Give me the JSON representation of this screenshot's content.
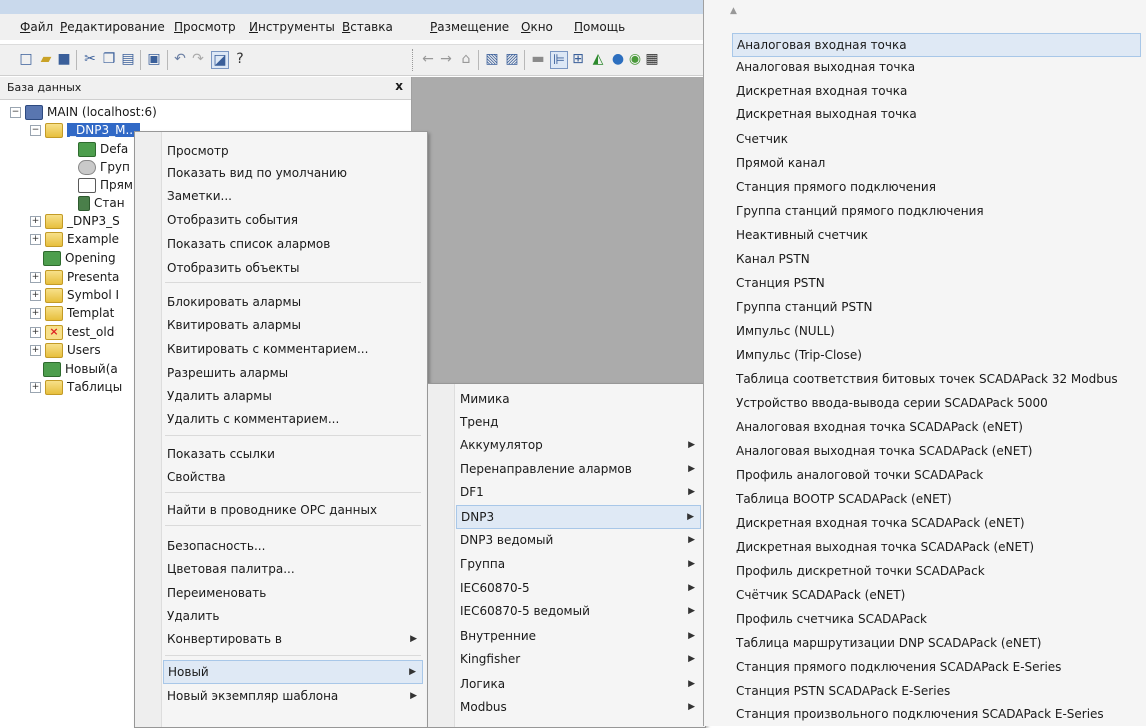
{
  "menubar": {
    "items": [
      {
        "label": "Файл",
        "u": "Ф",
        "rest": "айл"
      },
      {
        "label": "Редактирование",
        "u": "Р",
        "rest": "едактирование"
      },
      {
        "label": "Просмотр",
        "u": "П",
        "rest": "росмотр"
      },
      {
        "label": "Инструменты",
        "u": "И",
        "rest": "нструменты"
      },
      {
        "label": "Вставка",
        "u": "В",
        "rest": "ставка"
      },
      {
        "label": "Размещение",
        "u": "Р",
        "rest": "азмещение"
      },
      {
        "label": "Окно",
        "u": "О",
        "rest": "кно"
      },
      {
        "label": "Помощь",
        "u": "П",
        "rest": "омощь"
      }
    ]
  },
  "db_panel": {
    "title": "База данных",
    "close": "x",
    "tree": [
      {
        "label": "MAIN (localhost:6)",
        "icon": "pc-icon"
      },
      {
        "label": "_DNP3_M...",
        "icon": "folder-icon"
      },
      {
        "label": "Defa",
        "icon": "green-icon"
      },
      {
        "label": "Груп",
        "icon": "group-icon"
      },
      {
        "label": "Прям",
        "icon": "direct-icon"
      },
      {
        "label": "Стан",
        "icon": "station-icon"
      },
      {
        "label": "_DNP3_S",
        "icon": "folder-icon"
      },
      {
        "label": "Example",
        "icon": "folder-icon"
      },
      {
        "label": "Opening",
        "icon": "green-icon"
      },
      {
        "label": "Presenta",
        "icon": "folder-icon"
      },
      {
        "label": "Symbol I",
        "icon": "folder-icon"
      },
      {
        "label": "Templat",
        "icon": "folder-icon"
      },
      {
        "label": "test_old",
        "icon": "folder-x-icon"
      },
      {
        "label": "Users",
        "icon": "folder-icon"
      },
      {
        "label": "Новый(а",
        "icon": "green-icon"
      },
      {
        "label": "Таблицы",
        "icon": "folder-icon"
      }
    ]
  },
  "context_menu": {
    "items": [
      "Просмотр",
      "Показать вид по умолчанию",
      "Заметки...",
      "Отобразить события",
      "Показать список алармов",
      "Отобразить объекты",
      "Блокировать алармы",
      "Квитировать алармы",
      "Квитировать с комментарием...",
      "Разрешить алармы",
      "Удалить алармы",
      "Удалить с комментарием...",
      "Показать ссылки",
      "Свойства",
      "Найти в проводнике OPC данных",
      "Безопасность...",
      "Цветовая палитра...",
      "Переименовать",
      "Удалить",
      "Конвертировать в",
      "Новый",
      "Новый экземпляр шаблона"
    ]
  },
  "submenu_new": {
    "items": [
      "Мимика",
      "Тренд",
      "Аккумулятор",
      "Перенаправление алармов",
      "DF1",
      "DNP3",
      "DNP3 ведомый",
      "Группа",
      "IEC60870-5",
      "IEC60870-5 ведомый",
      "Внутренние",
      "Kingfisher",
      "Логика",
      "Modbus"
    ]
  },
  "submenu_dnp3": {
    "scroll_up": "▲",
    "items": [
      "Аналоговая входная точка",
      "Аналоговая выходная точка",
      "Дискретная входная точка",
      "Дискретная выходная точка",
      "Счетчик",
      "Прямой канал",
      "Станция прямого подключения",
      "Группа станций прямого подключения",
      "Неактивный счетчик",
      "Канал PSTN",
      "Станция PSTN",
      "Группа станций PSTN",
      "Импульс (NULL)",
      "Импульс (Trip-Close)",
      "Таблица соответствия битовых точек SCADAPack 32 Modbus",
      "Устройство ввода-вывода серии SCADAPack 5000",
      "Аналоговая входная точка SCADAPack (eNET)",
      "Аналоговая выходная точка SCADAPack (eNET)",
      "Профиль аналоговой точки SCADAPack",
      "Таблица BOOTP SCADAPack (eNET)",
      "Дискретная входная точка SCADAPack (eNET)",
      "Дискретная выходная точка SCADAPack (eNET)",
      "Профиль дискретной точки SCADAPack",
      "Счётчик SCADAPack (eNET)",
      "Профиль счетчика SCADAPack",
      "Таблица маршрутизации DNP SCADAPack (eNET)",
      "Станция прямого подключения SCADAPack E-Series",
      "Станция PSTN SCADAPack E-Series",
      "Станция произвольного подключения SCADAPack E-Series"
    ]
  }
}
